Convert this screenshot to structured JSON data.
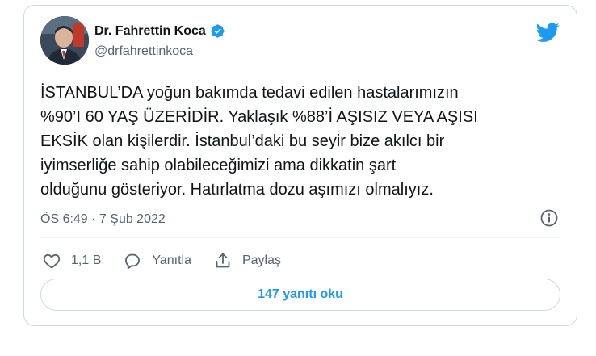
{
  "author": {
    "display_name": "Dr. Fahrettin Koca",
    "handle": "@drfahrettinkoca",
    "verified": true
  },
  "tweet": {
    "text": "İSTANBUL’DA yoğun bakımda tedavi edilen hastalarımızın\n%90’I 60 YAŞ ÜZERİDİR. Yaklaşık %88’İ AŞISIZ VEYA AŞISI\nEKSİK olan kişilerdir. İstanbul’daki bu seyir bize akılcı bir\niyimserliğe sahip olabileceğimizi ama dikkatin şart\nolduğunu gösteriyor. Hatırlatma dozu aşımızı olmalıyız.",
    "timestamp": "ÖS 6:49 · 7 Şub 2022"
  },
  "actions": {
    "like_count": "1,1 B",
    "reply_label": "Yanıtla",
    "share_label": "Paylaş"
  },
  "read_replies_label": "147 yanıtı oku",
  "icons": {
    "brand": "twitter-bird-icon",
    "verified": "verified-badge-icon",
    "info": "info-icon",
    "like": "heart-icon",
    "reply": "speech-bubble-icon",
    "share": "share-upload-icon"
  },
  "colors": {
    "twitter_blue": "#1d9bf0",
    "text_primary": "#0f1419",
    "text_secondary": "#536471",
    "border": "#cfd9de"
  }
}
